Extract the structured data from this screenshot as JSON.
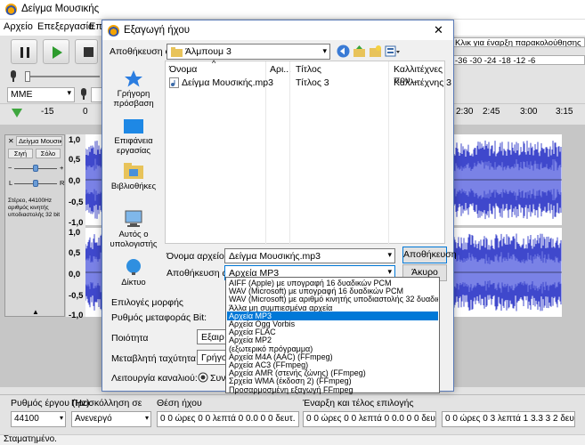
{
  "main_window": {
    "title": "Δείγμα Μουσικής",
    "menu": [
      "Αρχείο",
      "Επεξεργασία",
      "Επιλ"
    ],
    "meter_text_top": "Κλικ για έναρξη παρακολούθησης",
    "meter_text_bottom": "-36 -30 -24 -18 -12 -6",
    "host_combo": "MME",
    "ruler_left": [
      "-15",
      "0"
    ],
    "ruler_right": [
      "2:30",
      "2:45",
      "3:00",
      "3:15"
    ]
  },
  "track": {
    "name": "Δείγμα Μουσική",
    "mute_label": "Σιγή",
    "solo_label": "Σόλο",
    "pan_left": "L",
    "pan_right": "R",
    "info": "Στέρεο, 44100Hz αριθμός κινητής υποδιαστολής 32 bit",
    "y_labels": [
      "1,0",
      "0,5",
      "0,0",
      "-0,5",
      "-1,0",
      "1,0",
      "0,5",
      "0,0",
      "-0,5",
      "-1,0"
    ]
  },
  "selection_toolbar": {
    "rate_label": "Ρυθμός έργου (Hz):",
    "rate_value": "44100",
    "snap_label": "Προσκόλληση σε",
    "snap_value": "Ανενεργό",
    "pos_label": "Θέση ήχου",
    "pos_value": "0 0 ώρες 0 0 λεπτά 0 0.0 0 0 δευτ.",
    "range_label": "Έναρξη και τέλος επιλογής",
    "start_value": "0 0 ώρες 0 0 λεπτά 0 0.0 0 0 δευτ.",
    "end_value": "0 0 ώρες 0 3 λεπτά 1 3.3 3 2 δευτ."
  },
  "status_text": "Σταματημένο.",
  "dialog": {
    "title": "Εξαγωγή ήχου",
    "save_in_label": "Αποθήκευση σε:",
    "save_in_value": "Άλμπουμ 3",
    "places": [
      "Γρήγορη πρόσβαση",
      "Επιφάνεια εργασίας",
      "Βιβλιοθήκες",
      "Αυτός ο υπολογιστής",
      "Δίκτυο"
    ],
    "columns": [
      "Όνομα",
      "Αρι...",
      "Τίτλος",
      "Καλλιτέχνες που..."
    ],
    "file": {
      "name": "Δείγμα Μουσικής.mp3",
      "title": "Τίτλος 3",
      "artist": "Καλλιτέχνης 3"
    },
    "filename_label": "Όνομα αρχείου:",
    "filename_value": "Δείγμα Μουσικής.mp3",
    "save_as_label": "Αποθήκευση ως:",
    "save_as_value": "Αρχεία MP3",
    "save_button": "Αποθήκευση",
    "cancel_button": "Άκυρο",
    "options_label": "Επιλογές μορφής",
    "bitrate_label": "Ρυθμός μεταφοράς Bit:",
    "quality_label": "Ποιότητα",
    "quality_value": "Εξαιρ",
    "variable_label": "Μεταβλητή ταχύτητα",
    "variable_value": "Γρήγορ",
    "channel_label": "Λειτουργία καναλιού:",
    "channel_value": "Συνδ",
    "format_options": [
      "AIFF (Apple) με υπογραφή 16 δυαδικών PCM",
      "WAV (Microsoft) με υπογραφή 16 δυαδικών PCM",
      "WAV (Microsoft) με αριθμό κινητής υποδιαστολής 32 δυαδικών PCM",
      "Άλλα μη συμπιεσμένα αρχεία",
      "Αρχεία MP3",
      "Αρχεία Ogg Vorbis",
      "Αρχεία FLAC",
      "Αρχεία MP2",
      "(εξωτερικό πρόγραμμα)",
      "Αρχεία M4A (AAC) (FFmpeg)",
      "Αρχεία AC3 (FFmpeg)",
      "Αρχεία AMR (στενής ζώνης) (FFmpeg)",
      "Σρχεία WMA (έκδοση 2) (FFmpeg)",
      "Προσαρμοσμένη εξαγωγή FFmpeg"
    ],
    "selected_format_index": 4
  },
  "colors": {
    "accent": "#0078d7",
    "wave": "#3f48cc",
    "wave_light": "#7a82e6"
  }
}
